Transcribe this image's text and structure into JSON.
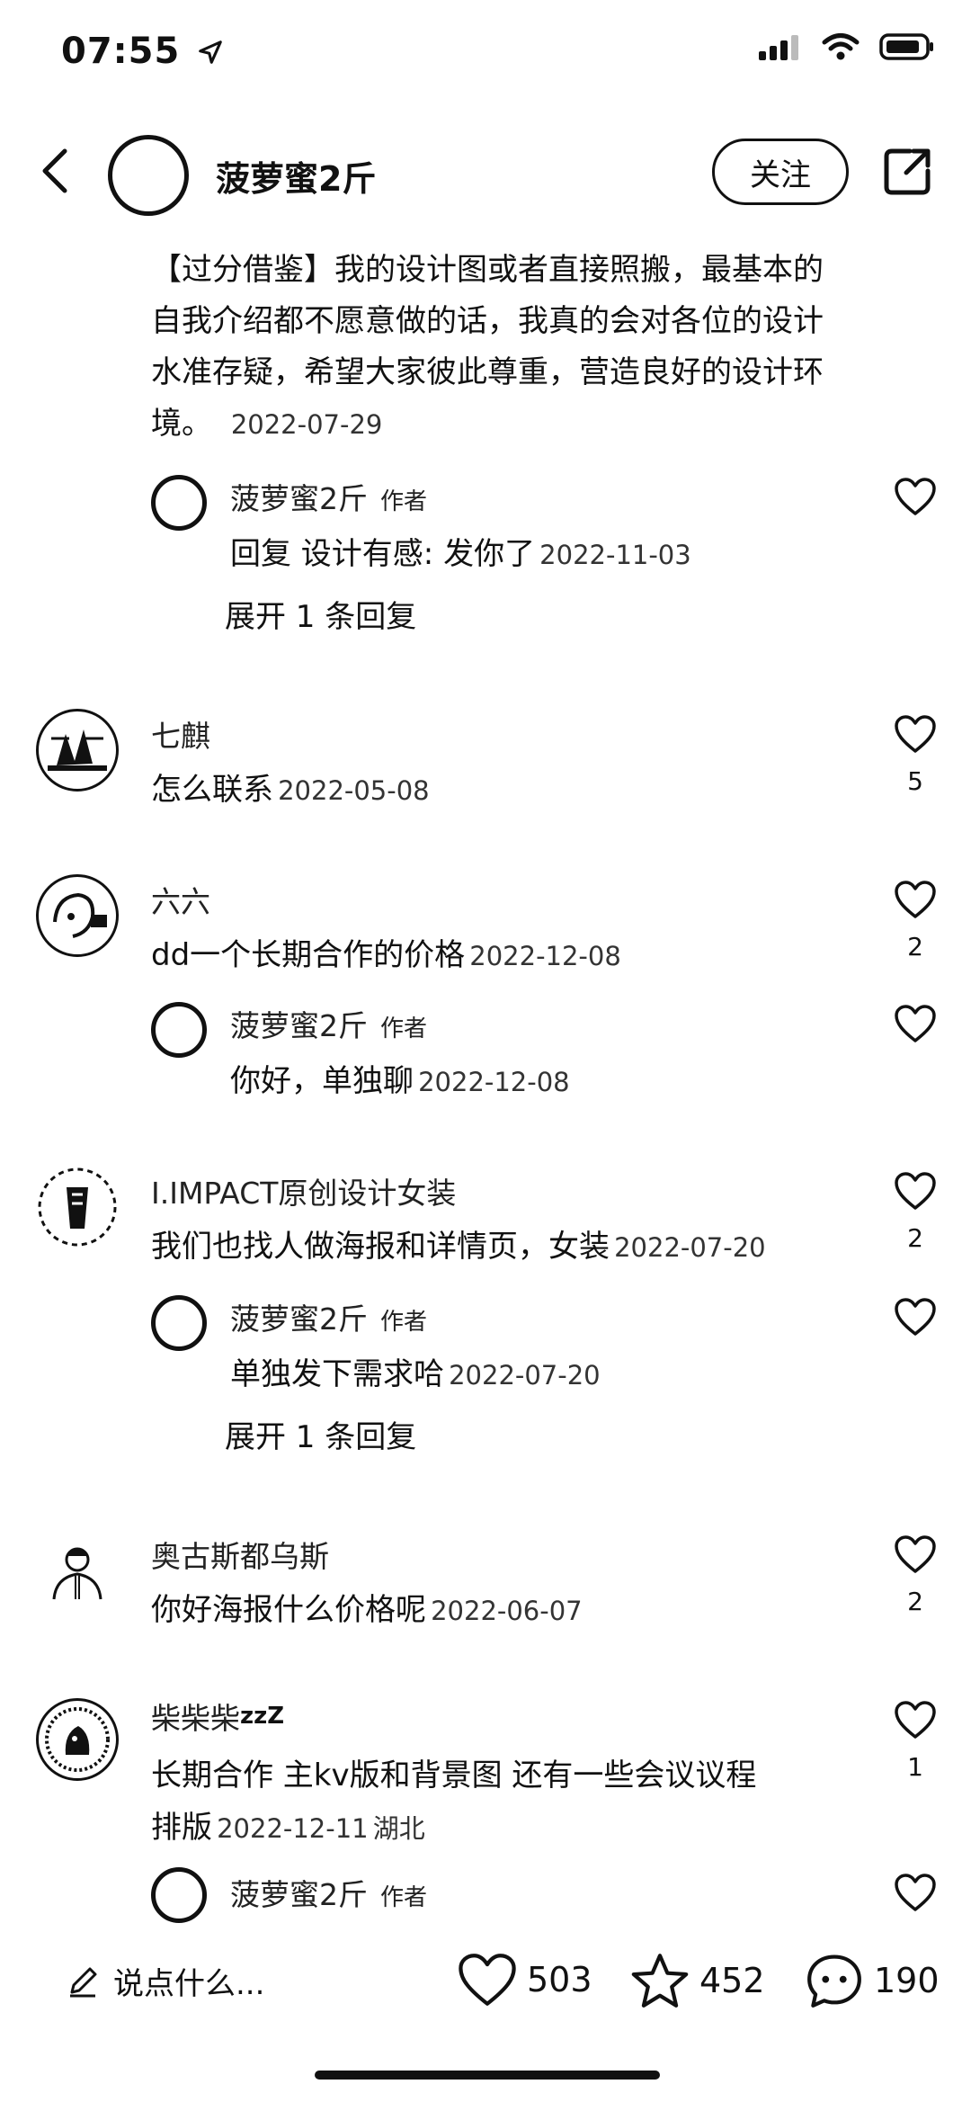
{
  "status_bar": {
    "time": "07:55"
  },
  "header": {
    "author_name": "菠萝蜜2斤",
    "follow_label": "关注"
  },
  "note": {
    "text": "【过分借鉴】我的设计图或者直接照搬，最基本的自我介绍都不愿意做的话，我真的会对各位的设计水准存疑，希望大家彼此尊重，营造良好的设计环境。",
    "date": "2022-07-29"
  },
  "comments": [
    {
      "name": "菠萝蜜2斤",
      "tag": "作者",
      "text": "回复 设计有感: 发你了",
      "date": "2022-11-03",
      "expand": "展开 1 条回复"
    },
    {
      "name": "七麒",
      "text": "怎么联系",
      "date": "2022-05-08",
      "likes": "5"
    },
    {
      "name": "六六",
      "text": "dd一个长期合作的价格",
      "date": "2022-12-08",
      "likes": "2"
    },
    {
      "name": "菠萝蜜2斤",
      "tag": "作者",
      "text": "你好，单独聊",
      "date": "2022-12-08"
    },
    {
      "name": "I.IMPACT原创设计女装",
      "text": "我们也找人做海报和详情页，女装",
      "date": "2022-07-20",
      "likes": "2"
    },
    {
      "name": "菠萝蜜2斤",
      "tag": "作者",
      "text": "单独发下需求哈",
      "date": "2022-07-20",
      "expand": "展开 1 条回复"
    },
    {
      "name": "奥古斯都乌斯",
      "text": "你好海报什么价格呢",
      "date": "2022-06-07",
      "likes": "2"
    },
    {
      "name": "柴柴柴",
      "name_suffix": "zzZ",
      "text_line1": "长期合作 主kv版和背景图 还有一些会议议程",
      "text_line2": "排版",
      "date": "2022-12-11",
      "location": "湖北",
      "likes": "1"
    },
    {
      "name": "菠萝蜜2斤",
      "tag": "作者"
    }
  ],
  "bottom_bar": {
    "input_placeholder": "说点什么...",
    "likes": "503",
    "favorites": "452",
    "comments": "190"
  }
}
